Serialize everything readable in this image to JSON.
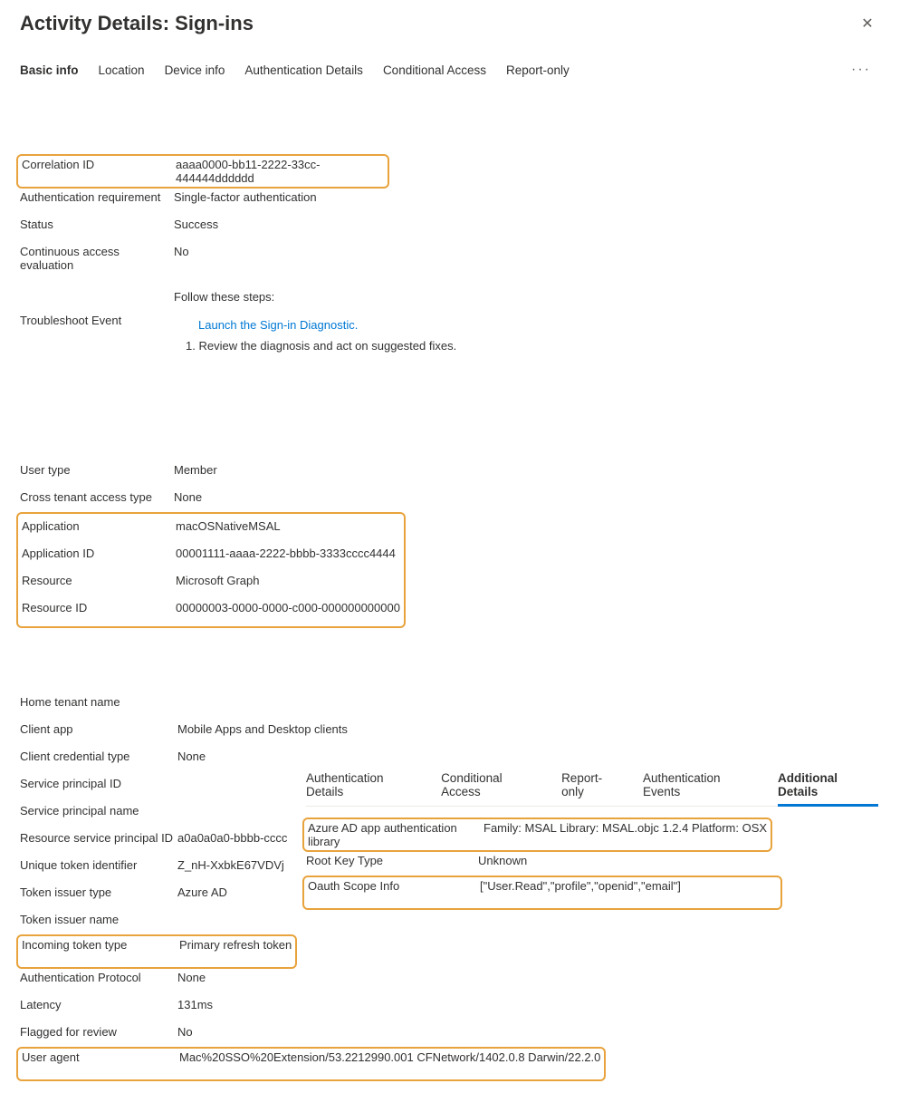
{
  "header": {
    "title": "Activity Details: Sign-ins"
  },
  "tabs": [
    "Basic info",
    "Location",
    "Device info",
    "Authentication Details",
    "Conditional Access",
    "Report-only"
  ],
  "section1": {
    "correlation_id_label": "Correlation ID",
    "correlation_id": "aaaa0000-bb11-2222-33cc-444444dddddd",
    "auth_req_label": "Authentication requirement",
    "auth_req": "Single-factor authentication",
    "status_label": "Status",
    "status": "Success",
    "cae_label": "Continuous access evaluation",
    "cae": "No",
    "troubleshoot_label": "Troubleshoot Event",
    "follow_steps": "Follow these steps:",
    "link": "Launch the Sign-in Diagnostic.",
    "step1": "1. Review the diagnosis and act on suggested fixes."
  },
  "section2": {
    "user_type_label": "User type",
    "user_type": "Member",
    "ctat_label": "Cross tenant access type",
    "ctat": "None",
    "app_label": "Application",
    "app": "macOSNativeMSAL",
    "app_id_label": "Application ID",
    "app_id": "00001111-aaaa-2222-bbbb-3333cccc4444",
    "resource_label": "Resource",
    "resource": "Microsoft Graph",
    "resource_id_label": "Resource ID",
    "resource_id": "00000003-0000-0000-c000-000000000000"
  },
  "section3": {
    "home_tenant_label": "Home tenant name",
    "home_tenant": "",
    "client_app_label": "Client app",
    "client_app": "Mobile Apps and Desktop clients",
    "client_cred_label": "Client credential type",
    "client_cred": "None",
    "sp_id_label": "Service principal ID",
    "sp_id": "",
    "sp_name_label": "Service principal name",
    "sp_name": "",
    "rsp_id_label": "Resource service principal ID",
    "rsp_id": "a0a0a0a0-bbbb-cccc",
    "uti_label": "Unique token identifier",
    "uti": "Z_nH-XxbkE67VDVj",
    "tit_label": "Token issuer type",
    "tit": "Azure AD",
    "tin_label": "Token issuer name",
    "tin": "",
    "itt_label": "Incoming token type",
    "itt": "Primary refresh token",
    "ap_label": "Authentication Protocol",
    "ap": "None",
    "latency_label": "Latency",
    "latency": "131ms",
    "flagged_label": "Flagged for review",
    "flagged": "No",
    "ua_label": "User agent",
    "ua": "Mac%20SSO%20Extension/53.2212990.001 CFNetwork/1402.0.8 Darwin/22.2.0"
  },
  "inner_tabs": [
    "Authentication Details",
    "Conditional Access",
    "Report-only",
    "Authentication Events",
    "Additional Details"
  ],
  "inner_rows": {
    "lib_label": "Azure AD app authentication library",
    "lib_value": "Family: MSAL Library: MSAL.objc 1.2.4 Platform: OSX",
    "rkt_label": "Root Key Type",
    "rkt_value": "Unknown",
    "scope_label": "Oauth Scope Info",
    "scope_value": "[\"User.Read\",\"profile\",\"openid\",\"email\"]"
  }
}
